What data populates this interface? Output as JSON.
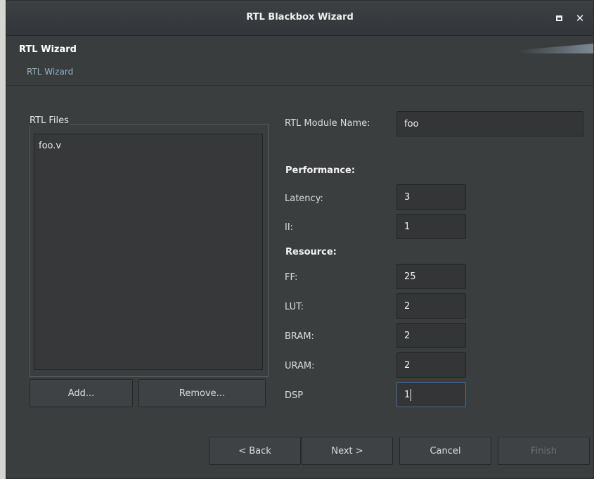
{
  "window": {
    "title": "RTL Blackbox Wizard"
  },
  "header": {
    "title": "RTL Wizard",
    "subtitle": "RTL Wizard"
  },
  "rtl_files": {
    "group_label": "RTL Files",
    "files": [
      "foo.v"
    ],
    "add_label": "Add...",
    "remove_label": "Remove..."
  },
  "form": {
    "module_name_label": "RTL Module Name:",
    "module_name_value": "foo",
    "performance_heading": "Performance:",
    "latency_label": "Latency:",
    "latency_value": "3",
    "ii_label": "II:",
    "ii_value": "1",
    "resource_heading": "Resource:",
    "ff_label": "FF:",
    "ff_value": "25",
    "lut_label": "LUT:",
    "lut_value": "2",
    "bram_label": "BRAM:",
    "bram_value": "2",
    "uram_label": "URAM:",
    "uram_value": "2",
    "dsp_label": "DSP",
    "dsp_value": "1"
  },
  "footer": {
    "back_label": "< Back",
    "next_label": "Next >",
    "cancel_label": "Cancel",
    "finish_label": "Finish"
  },
  "icons": {
    "maximize": "maximize-icon",
    "close": "close-icon"
  }
}
